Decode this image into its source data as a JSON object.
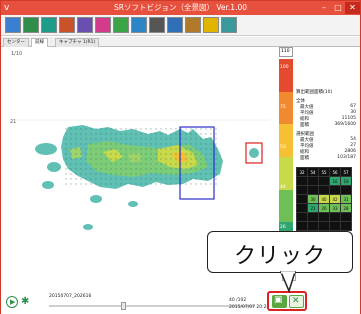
{
  "window": {
    "title": "SRソフトビジョン（全景図） Ver.1.00",
    "min_glyph": "–",
    "max_glyph": "□",
    "close_glyph": "✕",
    "app_icon": "v"
  },
  "toolbar": {
    "buttons": [
      {
        "name": "image-icon",
        "color": "#3b7fd0"
      },
      {
        "name": "chart-icon",
        "color": "#2f8f4a"
      },
      {
        "name": "map-icon",
        "color": "#1e9c8a"
      },
      {
        "name": "grid-icon",
        "color": "#c9522b"
      },
      {
        "name": "edit-icon",
        "color": "#6a4fb0"
      },
      {
        "name": "color-icon",
        "color": "#d23c8a"
      },
      {
        "name": "zoom-icon",
        "color": "#3aa447"
      },
      {
        "name": "search-icon",
        "color": "#2b85c7"
      },
      {
        "name": "camera-icon",
        "color": "#555555"
      },
      {
        "name": "settings-icon",
        "color": "#2f6fb5"
      },
      {
        "name": "pen-icon",
        "color": "#b07a2a"
      },
      {
        "name": "help-icon",
        "color": "#e0b400"
      },
      {
        "name": "globe-icon",
        "color": "#3a9a9a"
      }
    ]
  },
  "tabs": [
    "センター",
    "前線",
    "キャプチャ 1(R1)"
  ],
  "map": {
    "scale_top": "1/10",
    "row_marker": "21"
  },
  "colorbar": {
    "select_value": "110",
    "labels": [
      "100",
      "75",
      "50",
      "44",
      "26"
    ],
    "colors": [
      "#e34a2e",
      "#f08a30",
      "#f5c034",
      "#c8d94a",
      "#6fbf57",
      "#2fa66e"
    ]
  },
  "stats": {
    "header_label": "算出範囲面積(10)",
    "header_value": "10",
    "section1": "全体",
    "rows1": [
      {
        "label": "最大値",
        "value": "67"
      },
      {
        "label": "平均値",
        "value": "30"
      },
      {
        "label": "総和",
        "value": "11105"
      },
      {
        "label": "面積",
        "value": "369/1600"
      }
    ],
    "section2": "選択範囲",
    "rows2": [
      {
        "label": "最大値",
        "value": "54"
      },
      {
        "label": "平均値",
        "value": "27"
      },
      {
        "label": "総和",
        "value": "2806"
      },
      {
        "label": "面積",
        "value": "103/187"
      }
    ]
  },
  "grid": {
    "header": [
      "32",
      "54",
      "55",
      "56",
      "57"
    ],
    "rows": [
      [
        "",
        "",
        "",
        "16",
        "19"
      ],
      [
        "",
        "",
        "",
        "",
        ""
      ],
      [
        "",
        "30",
        "40",
        "42",
        "31"
      ],
      [
        "",
        "21",
        "26",
        "33",
        "28"
      ],
      [
        "",
        "",
        "",
        "",
        ""
      ],
      [
        "",
        "",
        "",
        "",
        ""
      ]
    ]
  },
  "bottom": {
    "filename": "20150707_202616",
    "frame": "40 /102",
    "timestamp": "2015/07/07 20:26:26.183",
    "mini_label": "10"
  },
  "callout": {
    "text": "クリック"
  }
}
